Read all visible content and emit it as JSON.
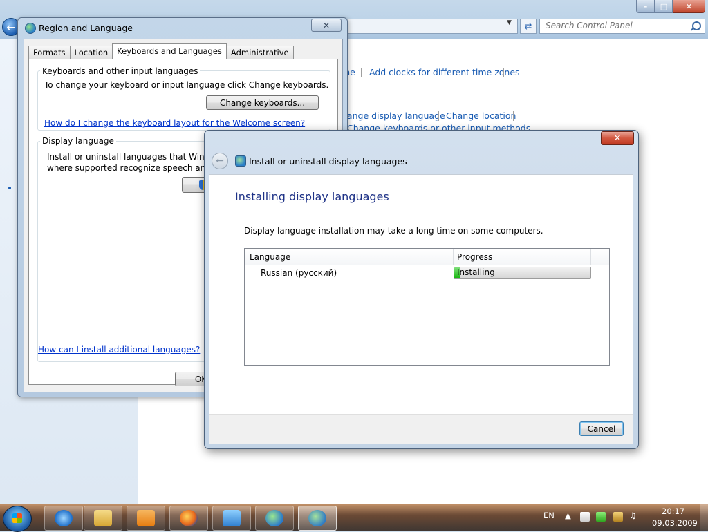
{
  "control_panel": {
    "search_placeholder": "Search Control Panel",
    "links": {
      "me_fragment": "me",
      "add_clocks": "Add clocks for different time zones",
      "change_display_language": "hange display language",
      "change_location": "Change location",
      "change_keyboards": "Change keyboards or other input methods"
    }
  },
  "region_dialog": {
    "title": "Region and Language",
    "tabs": [
      "Formats",
      "Location",
      "Keyboards and Languages",
      "Administrative"
    ],
    "active_tab": "Keyboards and Languages",
    "keyboards_group": {
      "label": "Keyboards and other input languages",
      "description": "To change your keyboard or input language click Change keyboards.",
      "button": "Change keyboards...",
      "help_link": "How do I change the keyboard layout for the Welcome screen?"
    },
    "display_group": {
      "label": "Display language",
      "description_line1": "Install or uninstall languages that Windows",
      "description_line2": "where supported recognize speech and har"
    },
    "bottom_link": "How can I install additional languages?",
    "ok_button": "OK"
  },
  "install_dialog": {
    "window_title": "Install or uninstall display languages",
    "heading": "Installing display languages",
    "note": "Display language installation may take a long time on some computers.",
    "columns": [
      "Language",
      "Progress"
    ],
    "rows": [
      {
        "language": "Russian (русский)",
        "status": "Installing",
        "progress_percent": 4
      }
    ],
    "cancel_button": "Cancel"
  },
  "taskbar": {
    "language_indicator": "EN",
    "time": "20:17",
    "date": "09.03.2009",
    "apps": [
      "internet-explorer",
      "windows-explorer",
      "media-player",
      "firefox",
      "control-panel",
      "network-globe",
      "region-language"
    ],
    "active_app": "region-language"
  }
}
